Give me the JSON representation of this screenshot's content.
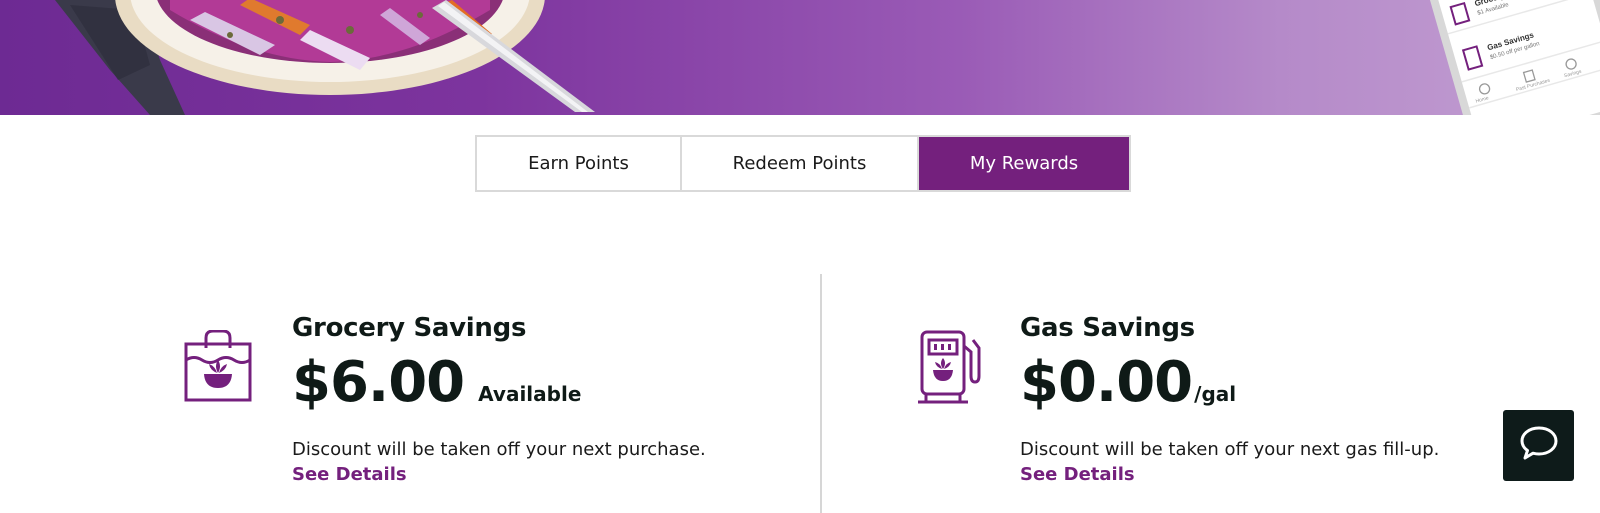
{
  "hero": {
    "phone_rows": [
      {
        "title": "Grocery",
        "subtitle": "$1 Available"
      },
      {
        "title": "Gas Savings",
        "subtitle": "$0.50 off per gallon"
      }
    ],
    "phone_nav": [
      "Home",
      "Past Purchases",
      "Savings"
    ]
  },
  "tabs": {
    "earn_label": "Earn Points",
    "redeem_label": "Redeem Points",
    "rewards_label": "My Rewards",
    "active": "My Rewards"
  },
  "grocery": {
    "icon": "grocery-bag-icon",
    "title": "Grocery Savings",
    "amount": "$6.00",
    "suffix": "Available",
    "description": "Discount will be taken off your next purchase.",
    "link": "See Details"
  },
  "gas": {
    "icon": "gas-pump-icon",
    "title": "Gas Savings",
    "amount": "$0.00",
    "suffix": "/gal",
    "description": "Discount will be taken off your next gas fill-up.",
    "link": "See Details"
  },
  "chat": {
    "icon": "chat-bubble-icon"
  },
  "colors": {
    "brand_purple": "#74207d",
    "heading_dark": "#0f1a17",
    "divider": "#d6d6d6",
    "chat_bg": "#0e1b1a"
  }
}
